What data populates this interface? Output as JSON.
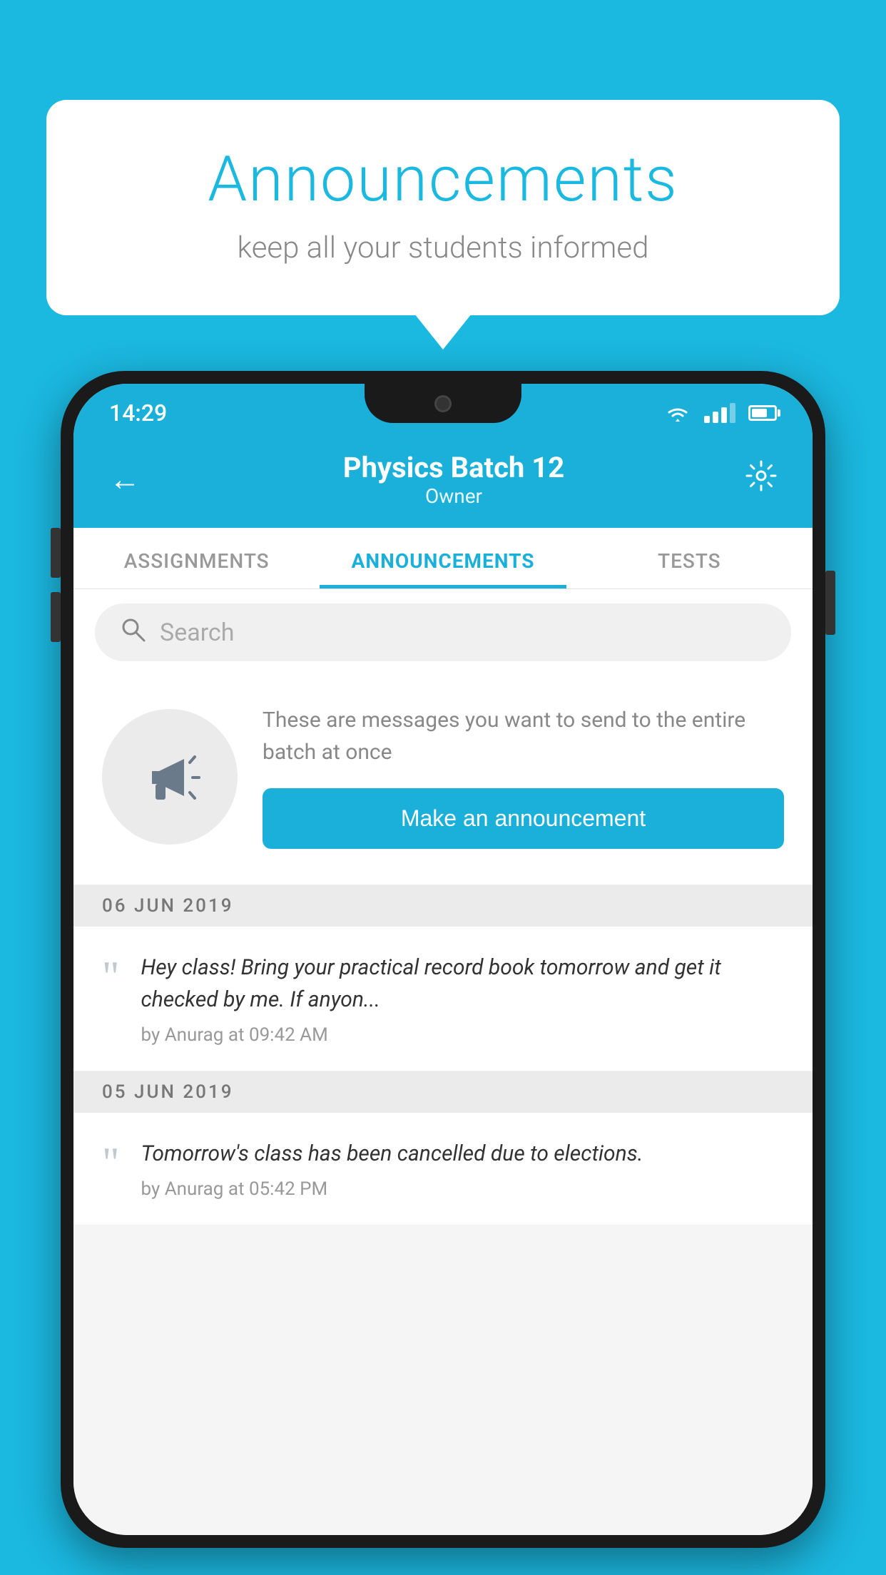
{
  "page": {
    "background_color": "#1bb8e0"
  },
  "speech_bubble": {
    "title": "Announcements",
    "subtitle": "keep all your students informed"
  },
  "status_bar": {
    "time": "14:29"
  },
  "header": {
    "title": "Physics Batch 12",
    "subtitle": "Owner",
    "back_label": "←",
    "settings_label": "⚙"
  },
  "tabs": [
    {
      "label": "ASSIGNMENTS",
      "active": false
    },
    {
      "label": "ANNOUNCEMENTS",
      "active": true
    },
    {
      "label": "TESTS",
      "active": false
    }
  ],
  "search": {
    "placeholder": "Search"
  },
  "announcement_prompt": {
    "description_text": "These are messages you want to send to the entire batch at once",
    "button_label": "Make an announcement"
  },
  "announcement_groups": [
    {
      "date": "06  JUN  2019",
      "items": [
        {
          "text": "Hey class! Bring your practical record book tomorrow and get it checked by me. If anyon...",
          "meta": "by Anurag at 09:42 AM"
        }
      ]
    },
    {
      "date": "05  JUN  2019",
      "items": [
        {
          "text": "Tomorrow's class has been cancelled due to elections.",
          "meta": "by Anurag at 05:42 PM"
        }
      ]
    }
  ]
}
